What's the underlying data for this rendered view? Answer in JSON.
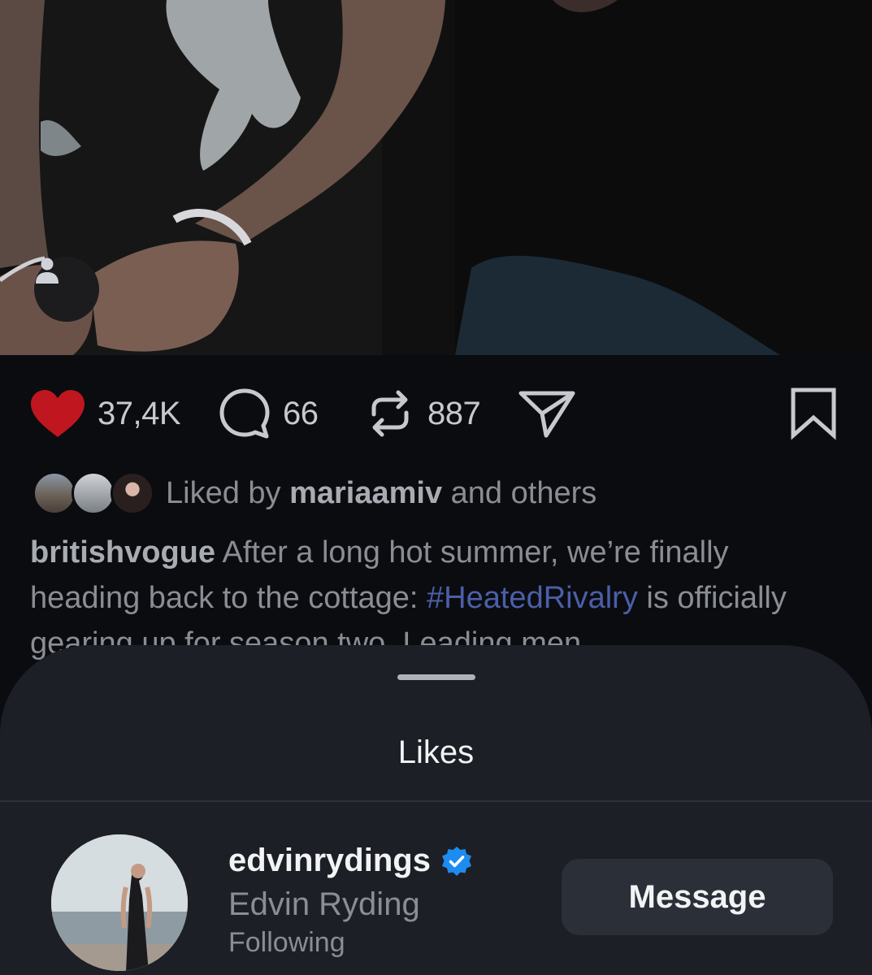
{
  "post": {
    "likes_count": "37,4K",
    "comments_count": "66",
    "reposts_count": "887"
  },
  "liked_by": {
    "prefix": "Liked by ",
    "user": "mariaamiv",
    "suffix": " and others"
  },
  "caption": {
    "author": "britishvogue",
    "text_part1": " After a long hot summer, we’re finally heading back to the cottage: ",
    "hashtag": "#HeatedRivalry",
    "text_part2": " is officially gearing up for season two. Leading men"
  },
  "likes_sheet": {
    "title": "Likes",
    "user": {
      "username": "edvinrydings",
      "full_name": "Edvin Ryding",
      "status": "Following",
      "button_label": "Message"
    }
  },
  "colors": {
    "like_red": "#c0161f",
    "verified_blue": "#1d8cf0",
    "hashtag_blue": "#4b5fa8"
  }
}
